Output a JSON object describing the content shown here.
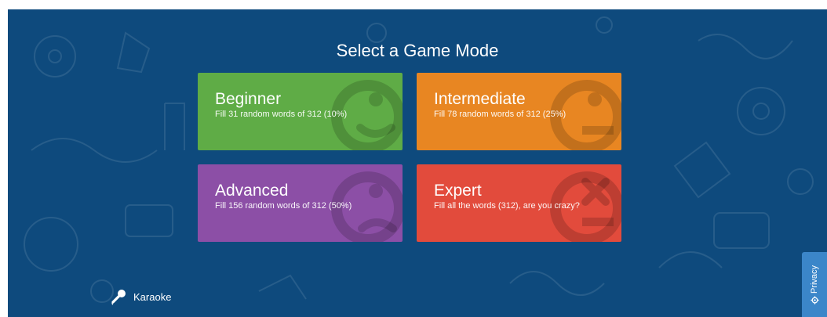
{
  "page": {
    "title": "Select a Game Mode"
  },
  "modes": [
    {
      "name": "Beginner",
      "description": "Fill 31 random words of 312 (10%)",
      "color": "#5fac46",
      "icon": "smiley-face-icon"
    },
    {
      "name": "Intermediate",
      "description": "Fill 78 random words of 312 (25%)",
      "color": "#e88622",
      "icon": "neutral-face-icon"
    },
    {
      "name": "Advanced",
      "description": "Fill 156 random words of 312 (50%)",
      "color": "#8c4fa6",
      "icon": "sad-face-icon"
    },
    {
      "name": "Expert",
      "description": "Fill all the words (312), are you crazy?",
      "color": "#e24b3c",
      "icon": "dead-face-icon"
    }
  ],
  "footer": {
    "karaoke_label": "Karaoke",
    "karaoke_icon": "microphone-icon"
  },
  "privacy": {
    "label": "Privacy",
    "icon": "gear-icon"
  },
  "colors": {
    "background": "#0e4a7d",
    "privacy_tab": "#3b86c9"
  }
}
